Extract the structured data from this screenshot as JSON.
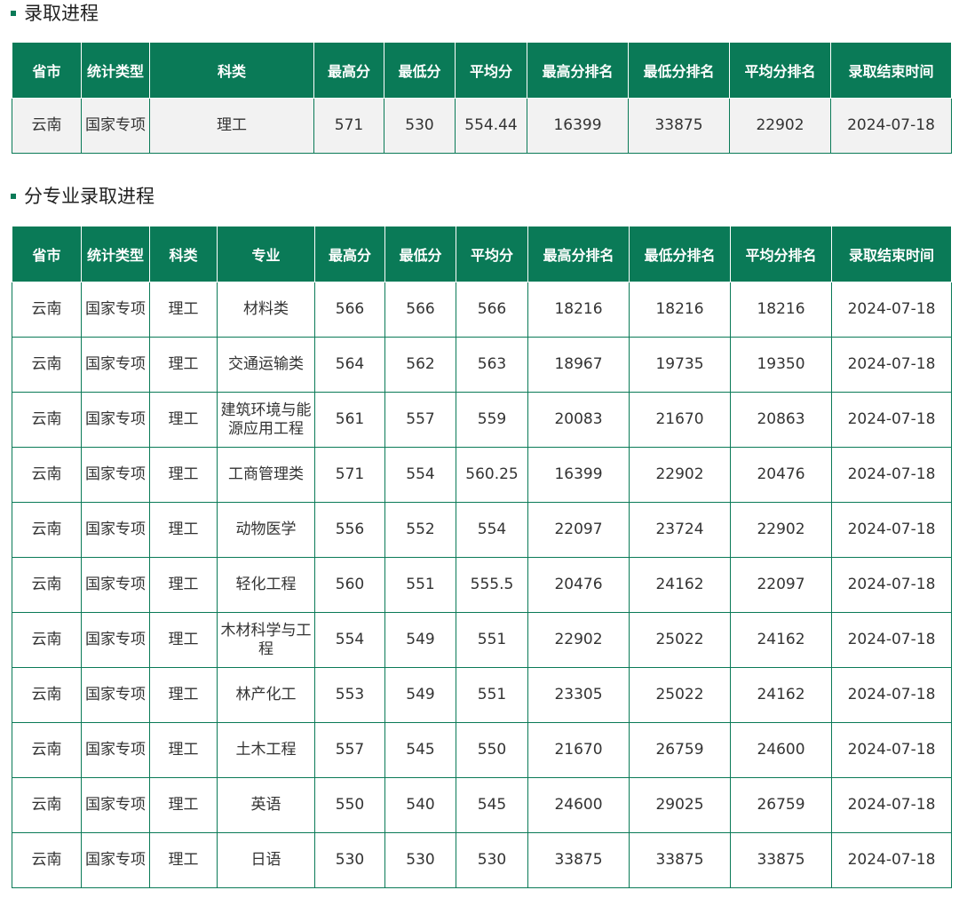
{
  "sections": {
    "summary": {
      "title": "录取进程",
      "headers": [
        "省市",
        "统计类型",
        "科类",
        "最高分",
        "最低分",
        "平均分",
        "最高分排名",
        "最低分排名",
        "平均分排名",
        "录取结束时间"
      ],
      "rows": [
        [
          "云南",
          "国家专项",
          "理工",
          "571",
          "530",
          "554.44",
          "16399",
          "33875",
          "22902",
          "2024-07-18"
        ]
      ]
    },
    "by_major": {
      "title": "分专业录取进程",
      "headers": [
        "省市",
        "统计类型",
        "科类",
        "专业",
        "最高分",
        "最低分",
        "平均分",
        "最高分排名",
        "最低分排名",
        "平均分排名",
        "录取结束时间"
      ],
      "rows": [
        [
          "云南",
          "国家专项",
          "理工",
          "材料类",
          "566",
          "566",
          "566",
          "18216",
          "18216",
          "18216",
          "2024-07-18"
        ],
        [
          "云南",
          "国家专项",
          "理工",
          "交通运输类",
          "564",
          "562",
          "563",
          "18967",
          "19735",
          "19350",
          "2024-07-18"
        ],
        [
          "云南",
          "国家专项",
          "理工",
          "建筑环境与能源应用工程",
          "561",
          "557",
          "559",
          "20083",
          "21670",
          "20863",
          "2024-07-18"
        ],
        [
          "云南",
          "国家专项",
          "理工",
          "工商管理类",
          "571",
          "554",
          "560.25",
          "16399",
          "22902",
          "20476",
          "2024-07-18"
        ],
        [
          "云南",
          "国家专项",
          "理工",
          "动物医学",
          "556",
          "552",
          "554",
          "22097",
          "23724",
          "22902",
          "2024-07-18"
        ],
        [
          "云南",
          "国家专项",
          "理工",
          "轻化工程",
          "560",
          "551",
          "555.5",
          "20476",
          "24162",
          "22097",
          "2024-07-18"
        ],
        [
          "云南",
          "国家专项",
          "理工",
          "木材科学与工程",
          "554",
          "549",
          "551",
          "22902",
          "25022",
          "24162",
          "2024-07-18"
        ],
        [
          "云南",
          "国家专项",
          "理工",
          "林产化工",
          "553",
          "549",
          "551",
          "23305",
          "25022",
          "24162",
          "2024-07-18"
        ],
        [
          "云南",
          "国家专项",
          "理工",
          "土木工程",
          "557",
          "545",
          "550",
          "21670",
          "26759",
          "24600",
          "2024-07-18"
        ],
        [
          "云南",
          "国家专项",
          "理工",
          "英语",
          "550",
          "540",
          "545",
          "24600",
          "29025",
          "26759",
          "2024-07-18"
        ],
        [
          "云南",
          "国家专项",
          "理工",
          "日语",
          "530",
          "530",
          "530",
          "33875",
          "33875",
          "33875",
          "2024-07-18"
        ]
      ]
    }
  },
  "colors": {
    "accent": "#0a7a57",
    "header_text": "#ffffff",
    "summary_row_bg": "#f2f2f2"
  }
}
